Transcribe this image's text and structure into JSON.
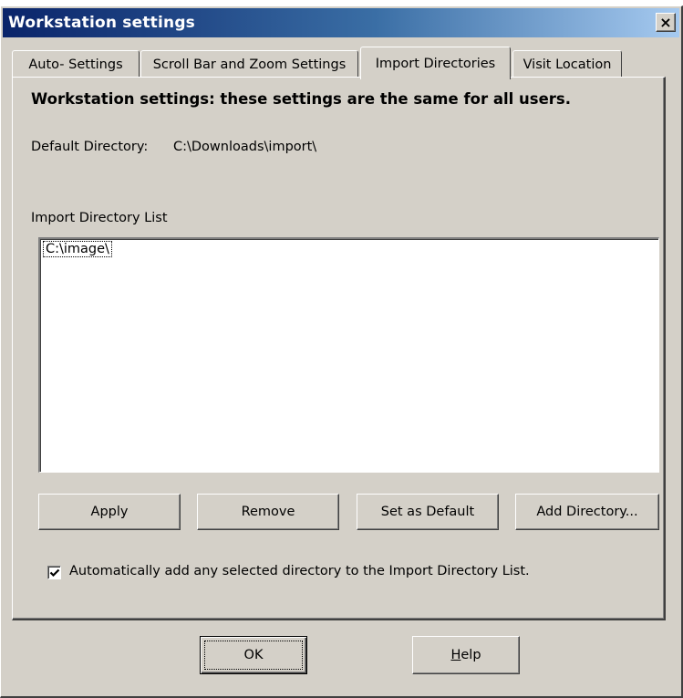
{
  "window": {
    "title": "Workstation settings",
    "close_glyph": "×"
  },
  "tabs": [
    {
      "label": "Auto- Settings",
      "active": false
    },
    {
      "label": "Scroll Bar and Zoom Settings",
      "active": false
    },
    {
      "label": "Import Directories",
      "active": true
    },
    {
      "label": "Visit Location",
      "active": false
    }
  ],
  "panel": {
    "heading": "Workstation settings: these settings are the same for all users.",
    "default_directory_label": "Default Directory:",
    "default_directory_value": "C:\\Downloads\\import\\",
    "list_label": "Import Directory List",
    "list_items": [
      "C:\\image\\"
    ]
  },
  "buttons": {
    "apply": "Apply",
    "remove": "Remove",
    "set_default": "Set as Default",
    "add_directory": "Add Directory..."
  },
  "auto_add": {
    "checked": true,
    "label": "Automatically add any selected directory to the Import Directory List."
  },
  "footer": {
    "ok": "OK",
    "help_mnemonic": "H",
    "help_rest": "elp"
  },
  "icons": {
    "close": "close-icon",
    "check": "checkmark-icon"
  }
}
